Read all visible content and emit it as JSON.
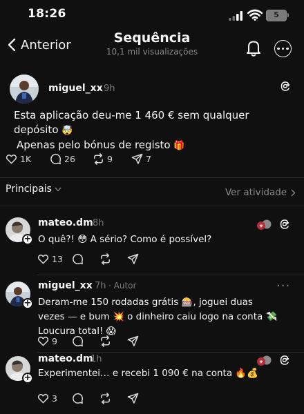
{
  "status_bar": {
    "time": "18:26",
    "battery": "5"
  },
  "nav": {
    "back_label": "Anterior",
    "title": "Sequência",
    "subtitle": "10,1 mil visualizações"
  },
  "post": {
    "username": "miguel_xx",
    "time": "9h",
    "text_line1": "Esta aplicação deu-me 1 460 € sem qualquer depósito",
    "emoji1": "🤯",
    "text_line2": "Apenas pelo bónus de registo",
    "emoji2": "🎁",
    "likes": "1K",
    "comments": "26",
    "reposts": "9",
    "shares": "7"
  },
  "filter": {
    "label": "Principais",
    "activity_label": "Ver atividade"
  },
  "replies": [
    {
      "username": "mateo.dm",
      "time": "8h",
      "text": "O quê?! 😳 A sério? Como é possível?",
      "likes": "13"
    },
    {
      "username": "miguel_xx",
      "time": "7h",
      "author_label": "Autor",
      "text_line1": "Deram-me 150 rodadas grátis 🎰, joguei duas",
      "text_line2": "vezes — e bum 💥 o dinheiro caiu logo na conta 💸",
      "text_line3": "Loucura total! 😱",
      "likes": "9"
    },
    {
      "username": "mateo.dm",
      "time": "1h",
      "text": "Experimentei… e recebi 1 090 € na conta 🔥💰",
      "likes": "3"
    }
  ],
  "colors": {
    "background": "#101010",
    "text": "#f3f5f7",
    "muted": "#7d7d7d"
  }
}
